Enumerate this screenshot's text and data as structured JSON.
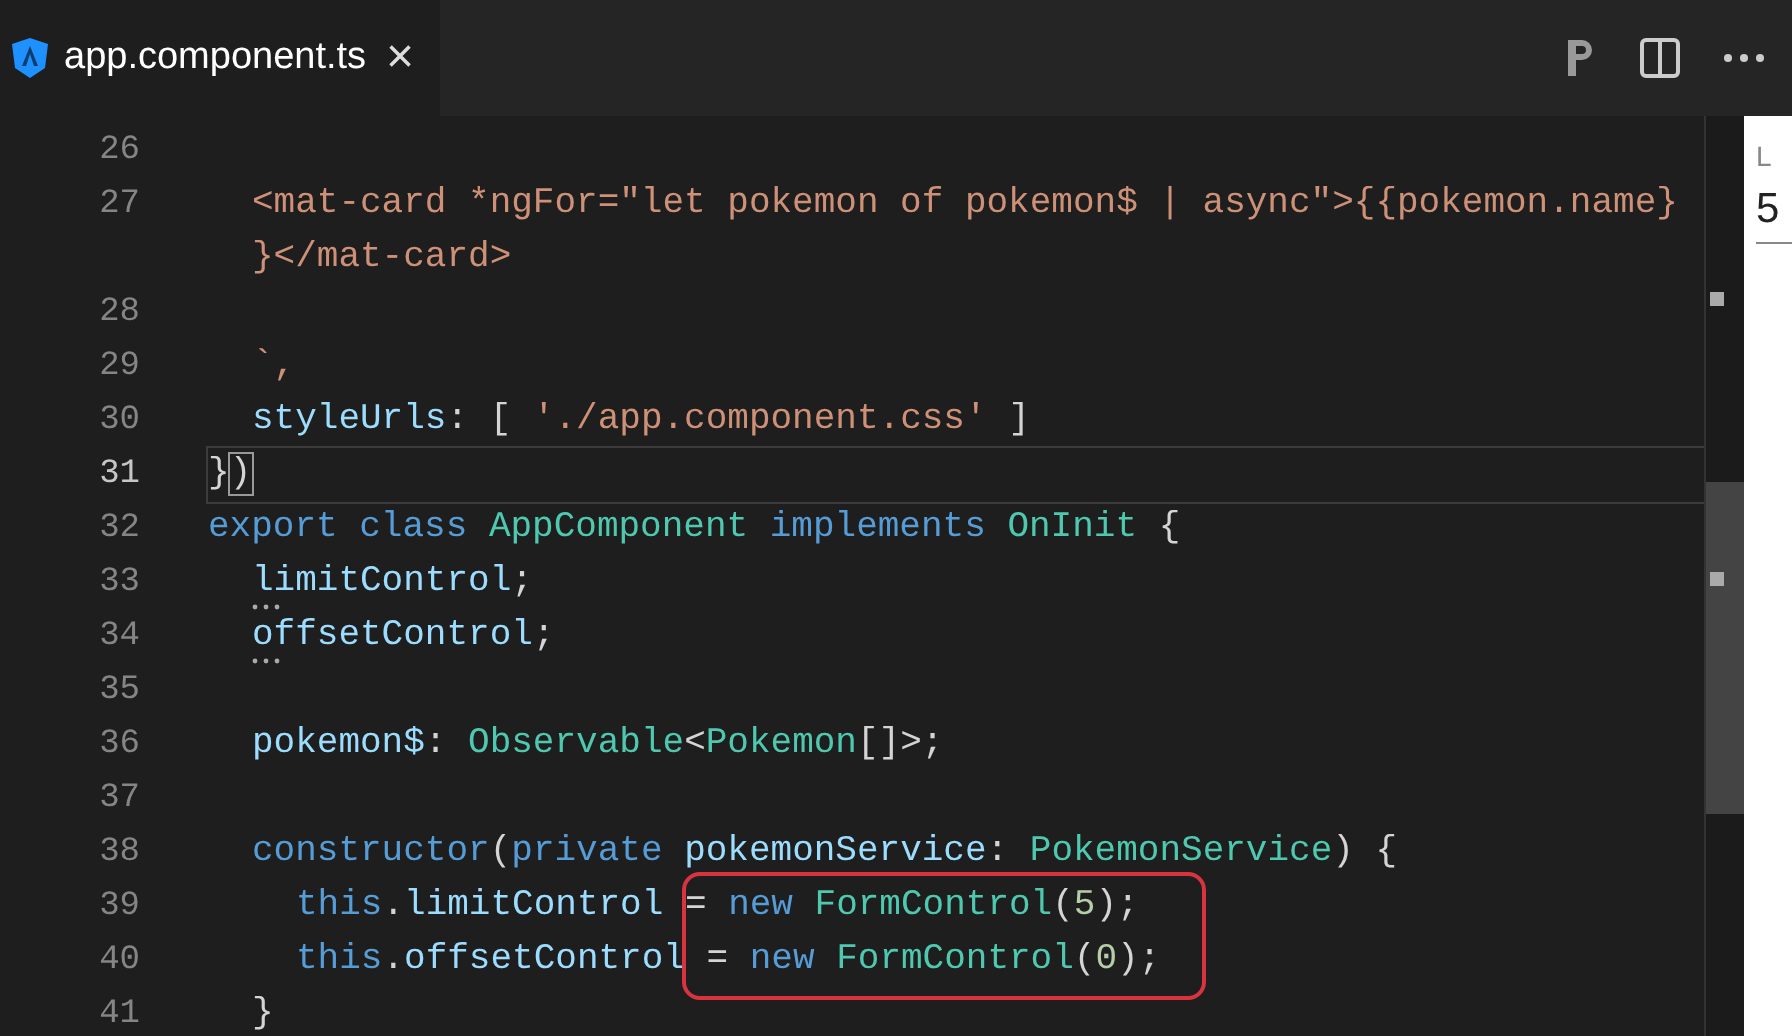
{
  "tab": {
    "title": "app.component.ts",
    "close": "×",
    "selected": true
  },
  "rows": [
    {
      "number": "26",
      "kind": "top",
      "current": false,
      "tokens": []
    },
    {
      "number": "27",
      "kind": "member",
      "current": false,
      "tokens": [
        {
          "kind": "string",
          "text": "<mat-card *ngFor=\"let pokemon of pokemon$ | async\">{{pokemon.name}"
        }
      ]
    },
    {
      "kind": "member",
      "current": false,
      "tokens": [
        {
          "kind": "string",
          "text": "}</mat-card>"
        }
      ]
    },
    {
      "number": "28",
      "kind": "top",
      "current": false,
      "tokens": []
    },
    {
      "number": "29",
      "kind": "member",
      "current": false,
      "tokens": [
        {
          "kind": "string",
          "text": "`,"
        }
      ]
    },
    {
      "number": "30",
      "kind": "member",
      "current": false,
      "tokens": [
        {
          "kind": "property",
          "text": "styleUrls"
        },
        {
          "kind": "plain",
          "text": ": [ "
        },
        {
          "kind": "string",
          "text": "'./app.component.css'"
        },
        {
          "kind": "plain",
          "text": " ]"
        }
      ]
    },
    {
      "number": "31",
      "kind": "top",
      "current": true,
      "tokens": [
        {
          "kind": "plain",
          "text": "}"
        },
        {
          "kind": "bracket",
          "text": ")"
        }
      ]
    },
    {
      "number": "32",
      "kind": "top",
      "current": false,
      "tokens": [
        {
          "kind": "keyword",
          "text": "export class "
        },
        {
          "kind": "type",
          "text": "AppComponent "
        },
        {
          "kind": "keyword",
          "text": "implements "
        },
        {
          "kind": "type",
          "text": "OnInit"
        },
        {
          "kind": "plain",
          "text": " {"
        }
      ]
    },
    {
      "number": "33",
      "kind": "member",
      "current": false,
      "hint": true,
      "tokens": [
        {
          "kind": "property",
          "text": "limitControl"
        },
        {
          "kind": "plain",
          "text": ";"
        }
      ]
    },
    {
      "number": "34",
      "kind": "member",
      "current": false,
      "hint": true,
      "tokens": [
        {
          "kind": "property",
          "text": "offsetControl"
        },
        {
          "kind": "plain",
          "text": ";"
        }
      ]
    },
    {
      "number": "35",
      "kind": "top",
      "current": false,
      "tokens": []
    },
    {
      "number": "36",
      "kind": "member",
      "current": false,
      "tokens": [
        {
          "kind": "property",
          "text": "pokemon$"
        },
        {
          "kind": "plain",
          "text": ": "
        },
        {
          "kind": "type",
          "text": "Observable"
        },
        {
          "kind": "plain",
          "text": "<"
        },
        {
          "kind": "type",
          "text": "Pokemon"
        },
        {
          "kind": "plain",
          "text": "[]>;"
        }
      ]
    },
    {
      "number": "37",
      "kind": "top",
      "current": false,
      "tokens": []
    },
    {
      "number": "38",
      "kind": "member",
      "current": false,
      "tokens": [
        {
          "kind": "keyword",
          "text": "constructor"
        },
        {
          "kind": "plain",
          "text": "("
        },
        {
          "kind": "keyword",
          "text": "private "
        },
        {
          "kind": "property",
          "text": "pokemonService"
        },
        {
          "kind": "plain",
          "text": ": "
        },
        {
          "kind": "type",
          "text": "PokemonService"
        },
        {
          "kind": "plain",
          "text": ") {"
        }
      ]
    },
    {
      "number": "39",
      "kind": "body",
      "current": false,
      "tokens": [
        {
          "kind": "keyword",
          "text": "this"
        },
        {
          "kind": "plain",
          "text": "."
        },
        {
          "kind": "property",
          "text": "limitControl"
        },
        {
          "kind": "plain",
          "text": " = "
        },
        {
          "kind": "keyword",
          "text": "new "
        },
        {
          "kind": "type",
          "text": "FormControl"
        },
        {
          "kind": "plain",
          "text": "("
        },
        {
          "kind": "number",
          "text": "5"
        },
        {
          "kind": "plain",
          "text": ");"
        }
      ]
    },
    {
      "number": "40",
      "kind": "body",
      "current": false,
      "tokens": [
        {
          "kind": "keyword",
          "text": "this"
        },
        {
          "kind": "plain",
          "text": "."
        },
        {
          "kind": "property",
          "text": "offsetControl"
        },
        {
          "kind": "plain",
          "text": " = "
        },
        {
          "kind": "keyword",
          "text": "new "
        },
        {
          "kind": "type",
          "text": "FormControl"
        },
        {
          "kind": "plain",
          "text": "("
        },
        {
          "kind": "number",
          "text": "0"
        },
        {
          "kind": "plain",
          "text": ");"
        }
      ]
    },
    {
      "number": "41",
      "kind": "member",
      "current": false,
      "tokens": [
        {
          "kind": "plain",
          "text": "}"
        }
      ]
    }
  ],
  "highlight_box": true,
  "preview": {
    "label": "L",
    "value": "5"
  }
}
